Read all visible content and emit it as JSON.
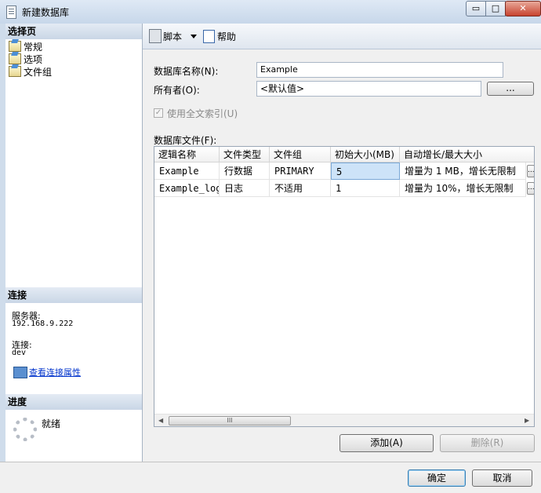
{
  "window": {
    "title": "新建数据库",
    "controls": {
      "minimize": "▭",
      "maximize": "□",
      "close": "✕"
    }
  },
  "left": {
    "select_page_header": "选择页",
    "pages": [
      {
        "label": "常规"
      },
      {
        "label": "选项"
      },
      {
        "label": "文件组"
      }
    ],
    "connection_header": "连接",
    "server_label": "服务器:",
    "server_value": "192.168.9.222",
    "connection_label": "连接:",
    "connection_value": "dev",
    "view_connection_link": "查看连接属性",
    "progress_header": "进度",
    "progress_status": "就绪"
  },
  "toolbar": {
    "script_label": "脚本",
    "help_label": "帮助"
  },
  "form": {
    "db_name_label": "数据库名称(N):",
    "db_name_value": "Example",
    "owner_label": "所有者(O):",
    "owner_value": "<默认值>",
    "browse_label": "...",
    "fulltext_label": "使用全文索引(U)",
    "fulltext_checked": true,
    "files_label": "数据库文件(F):"
  },
  "grid": {
    "columns": [
      "逻辑名称",
      "文件类型",
      "文件组",
      "初始大小(MB)",
      "自动增长/最大大小"
    ],
    "rows": [
      {
        "name": "Example",
        "type": "行数据",
        "group": "PRIMARY",
        "size": "5",
        "growth": "增量为 1 MB，增长无限制"
      },
      {
        "name": "Example_log",
        "type": "日志",
        "group": "不适用",
        "size": "1",
        "growth": "增量为 10%，增长无限制"
      }
    ],
    "cell_button": "...",
    "scroll_thumb_grip": "III",
    "scroll_left": "◀",
    "scroll_right": "▶"
  },
  "buttons": {
    "add": "添加(A)",
    "remove": "删除(R)",
    "ok": "确定",
    "cancel": "取消"
  },
  "colors": {
    "accent": "#3c7fb1",
    "link": "#0033cc",
    "selection": "#cde3f8"
  }
}
